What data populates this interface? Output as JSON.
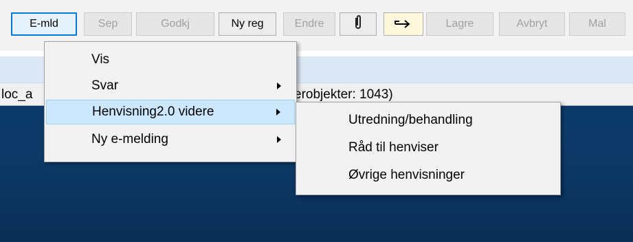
{
  "toolbar": {
    "buttons": [
      {
        "label": "E-mld"
      },
      {
        "label": "Sep"
      },
      {
        "label": "Godkj"
      },
      {
        "label": "Ny reg"
      },
      {
        "label": "Endre"
      },
      {
        "label": "Lagre"
      },
      {
        "label": "Avbryt"
      },
      {
        "label": "Mal"
      }
    ],
    "icons": {
      "attach": "paperclip-icon",
      "transfer": "transfer-icon"
    }
  },
  "status": {
    "left_text": "loc_a",
    "right_text": "erobjekter: 1043)"
  },
  "context_menu": {
    "items": [
      {
        "label": "Vis",
        "has_submenu": false
      },
      {
        "label": "Svar",
        "has_submenu": true
      },
      {
        "label": "Henvisning2.0 videre",
        "has_submenu": true
      },
      {
        "label": "Ny e-melding",
        "has_submenu": true
      }
    ]
  },
  "submenu": {
    "items": [
      {
        "label": "Utredning/behandling"
      },
      {
        "label": "Råd til henviser"
      },
      {
        "label": "Øvrige henvisninger"
      }
    ]
  },
  "colors": {
    "highlight": "#cce8ff",
    "desktop": "#0c3b6a",
    "focus": "#0078d7"
  }
}
